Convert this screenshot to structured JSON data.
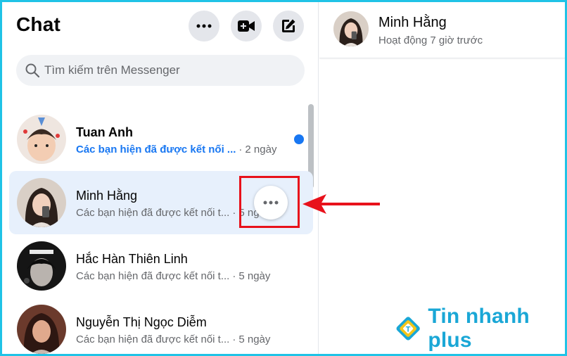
{
  "header": {
    "title": "Chat",
    "buttons": [
      "more-icon",
      "video-call-icon",
      "compose-icon"
    ]
  },
  "search": {
    "placeholder": "Tìm kiếm trên Messenger"
  },
  "conversations": [
    {
      "name": "Tuan Anh",
      "preview": "Các bạn hiện đã được kết nối ...",
      "time": "2 ngày",
      "unread": true
    },
    {
      "name": "Minh Hằng",
      "preview": "Các bạn hiện đã được kết nối t...",
      "time": "5 ngày",
      "active": true
    },
    {
      "name": "Hắc Hàn Thiên Linh",
      "preview": "Các bạn hiện đã được kết nối t...",
      "time": "5 ngày"
    },
    {
      "name": "Nguyễn Thị Ngọc Diễm",
      "preview": "Các bạn hiện đã được kết nối t...",
      "time": "5 ngày"
    }
  ],
  "chat": {
    "name": "Minh Hằng",
    "status": "Hoạt động 7 giờ trước"
  },
  "separator": "·",
  "watermark": {
    "text": "Tin nhanh plus"
  },
  "colors": {
    "accent": "#1877f2",
    "highlight": "#e8111b",
    "frame": "#1fc3e6",
    "active_row": "#e7f0fc"
  }
}
